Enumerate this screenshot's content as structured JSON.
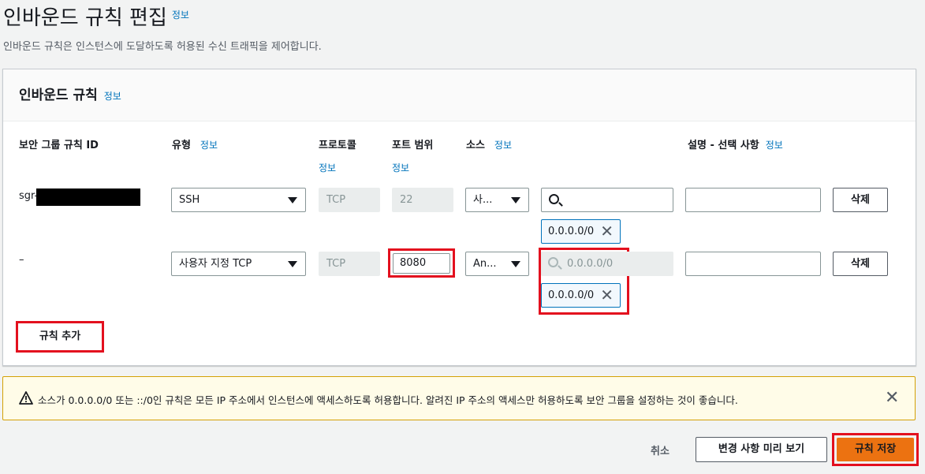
{
  "page": {
    "title": "인바운드 규칙 편집",
    "title_info": "정보",
    "description": "인바운드 규칙은 인스턴스에 도달하도록 허용된 수신 트래픽을 제어합니다."
  },
  "panel": {
    "title": "인바운드 규칙",
    "title_info": "정보"
  },
  "columns": {
    "rule_id": "보안 그룹 규칙 ID",
    "type": "유형",
    "type_info": "정보",
    "protocol": "프로토콜",
    "protocol_info": "정보",
    "port_range": "포트 범위",
    "port_info": "정보",
    "source": "소스",
    "source_info": "정보",
    "description": "설명 - 선택 사항",
    "description_info": "정보"
  },
  "rules": [
    {
      "rule_id": "sgr-",
      "type": "SSH",
      "protocol": "TCP",
      "port_range": "22",
      "source_type": "사...",
      "source_search": "",
      "source_token": "0.0.0.0/0",
      "description": "",
      "delete_label": "삭제"
    },
    {
      "rule_id": "–",
      "type": "사용자 지정 TCP",
      "protocol": "TCP",
      "port_range": "8080",
      "source_type": "An...",
      "source_search_placeholder": "0.0.0.0/0",
      "source_token": "0.0.0.0/0",
      "description": "",
      "delete_label": "삭제"
    }
  ],
  "add_rule_label": "규칙 추가",
  "warning": {
    "text": "소스가 0.0.0.0/0 또는 ::/0인 규칙은 모든 IP 주소에서 인스턴스에 액세스하도록 허용합니다. 알려진 IP 주소의 액세스만 허용하도록 보안 그룹을 설정하는 것이 좋습니다.",
    "icon": "warning-icon",
    "close_icon": "close-icon"
  },
  "footer": {
    "cancel_label": "취소",
    "preview_label": "변경 사항 미리 보기",
    "save_label": "규칙 저장"
  },
  "colors": {
    "primary": "#ec7211",
    "info_link": "#0073bb",
    "highlight": "#e3101e",
    "warning_border": "#d4a106"
  }
}
